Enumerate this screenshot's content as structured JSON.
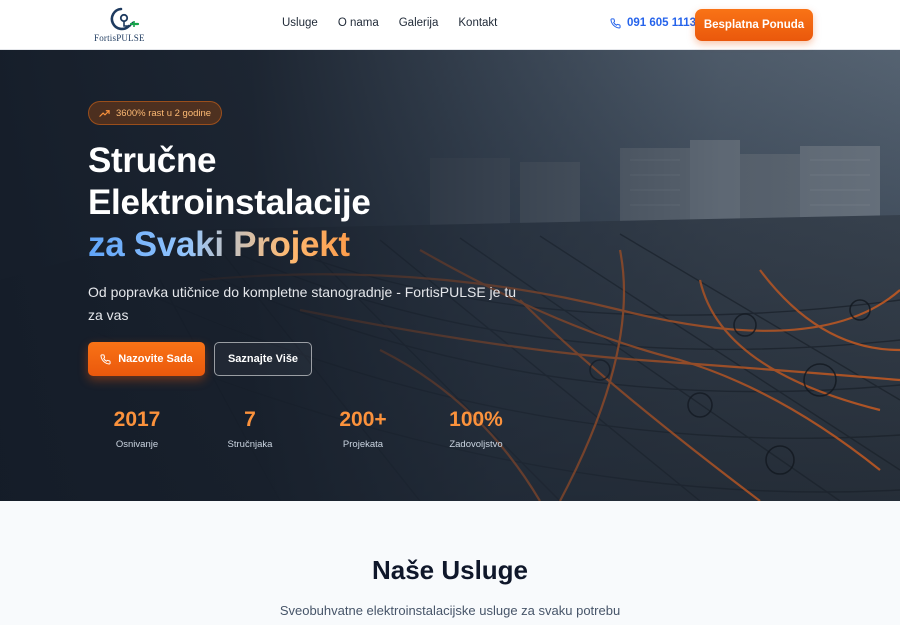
{
  "brand": {
    "logo_text": "FortisPULSE"
  },
  "nav": {
    "links": [
      "Usluge",
      "O nama",
      "Galerija",
      "Kontakt"
    ],
    "phone": "091 605 1113",
    "cta_label": "Besplatna Ponuda"
  },
  "hero": {
    "badge": "3600% rast u 2 godine",
    "title_line1": "Stručne",
    "title_line2": "Elektroinstalacije",
    "title_line3": "za Svaki Projekt",
    "subtitle": "Od popravka utičnice do kompletne stanogradnje - FortisPULSE je tu za vas",
    "primary_button": "Nazovite Sada",
    "secondary_button": "Saznajte Više",
    "stats": [
      {
        "value": "2017",
        "label": "Osnivanje"
      },
      {
        "value": "7",
        "label": "Stručnjaka"
      },
      {
        "value": "200+",
        "label": "Projekata"
      },
      {
        "value": "100%",
        "label": "Zadovoljstvo"
      }
    ]
  },
  "services": {
    "title": "Naše Usluge",
    "subtitle": "Sveobuhvatne elektroinstalacijske usluge za svaku potrebu"
  },
  "colors": {
    "accent_orange": "#f97316",
    "link_blue": "#2563eb",
    "hero_dark": "#1d2733"
  },
  "icons": {
    "phone": "phone-icon",
    "trend": "trending-up-icon",
    "logo": "plug-logo-icon"
  }
}
